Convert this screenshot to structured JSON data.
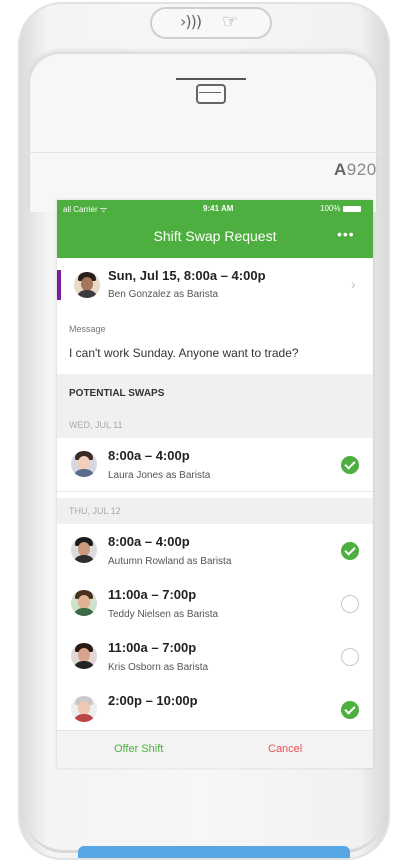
{
  "device": {
    "model_prefix": "A",
    "model_number": "920",
    "nfc_symbol": "›)))",
    "nfc_hand": "☞"
  },
  "status_bar": {
    "carrier": "all Carrier ᯤ",
    "time": "9:41 AM",
    "battery": "100%"
  },
  "header": {
    "title": "Shift Swap Request",
    "more": "•••",
    "color": "#4caf3f"
  },
  "shift": {
    "title": "Sun, Jul 15, 8:00a – 4:00p",
    "subtitle": "Ben Gonzalez as Barista",
    "accent_color": "#7b1fa2"
  },
  "message": {
    "label": "Message",
    "text": "I can't work Sunday. Anyone want to trade?"
  },
  "potential": {
    "header": "POTENTIAL SWAPS",
    "days": [
      {
        "label": "WED, JUL 11",
        "rows": [
          {
            "time": "8:00a – 4:00p",
            "who": "Laura Jones as Barista",
            "selected": true
          }
        ]
      },
      {
        "label": "THU, JUL 12",
        "rows": [
          {
            "time": "8:00a – 4:00p",
            "who": "Autumn Rowland as Barista",
            "selected": true
          },
          {
            "time": "11:00a – 7:00p",
            "who": "Teddy Nielsen as Barista",
            "selected": false
          },
          {
            "time": "11:00a – 7:00p",
            "who": "Kris Osborn as Barista",
            "selected": false
          },
          {
            "time": "2:00p – 10:00p",
            "who": "",
            "selected": true
          }
        ]
      }
    ]
  },
  "actions": {
    "offer": "Offer Shift",
    "cancel": "Cancel",
    "offer_color": "#4caf3f",
    "cancel_color": "#e55353"
  }
}
